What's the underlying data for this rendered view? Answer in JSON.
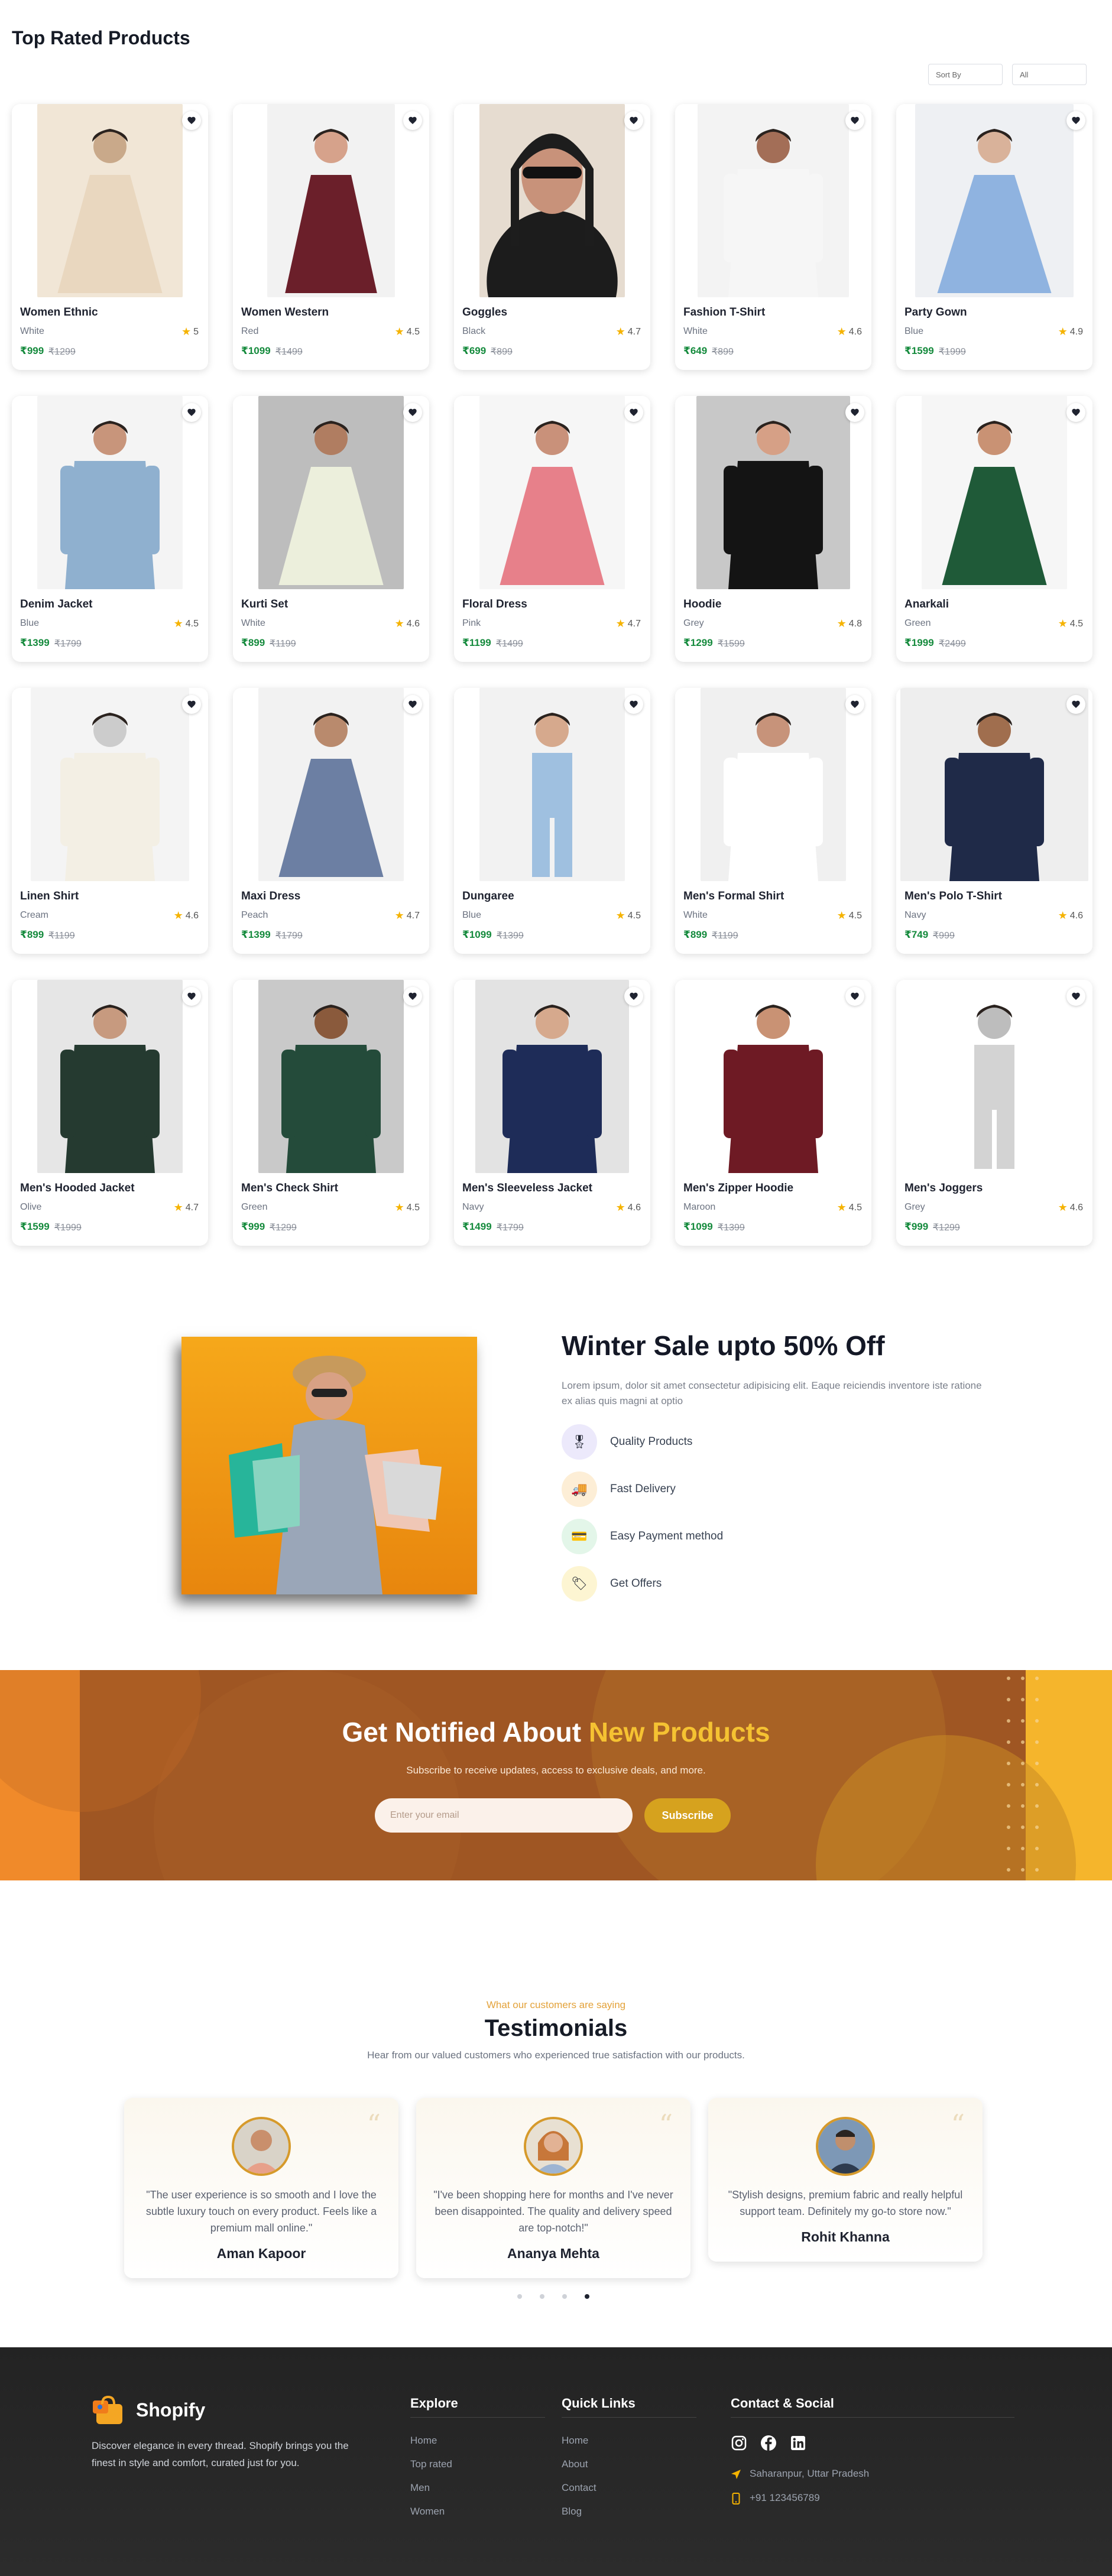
{
  "page": {
    "title": "Top Rated Products"
  },
  "filters": {
    "sort_placeholder": "Sort By",
    "category_value": "All"
  },
  "products": [
    {
      "name": "Women Ethnic",
      "color": "White",
      "rating": "5",
      "price": "₹999",
      "mrp": "₹1299"
    },
    {
      "name": "Women Western",
      "color": "Red",
      "rating": "4.5",
      "price": "₹1099",
      "mrp": "₹1499"
    },
    {
      "name": "Goggles",
      "color": "Black",
      "rating": "4.7",
      "price": "₹699",
      "mrp": "₹899"
    },
    {
      "name": "Fashion T-Shirt",
      "color": "White",
      "rating": "4.6",
      "price": "₹649",
      "mrp": "₹899"
    },
    {
      "name": "Party Gown",
      "color": "Blue",
      "rating": "4.9",
      "price": "₹1599",
      "mrp": "₹1999"
    },
    {
      "name": "Denim Jacket",
      "color": "Blue",
      "rating": "4.5",
      "price": "₹1399",
      "mrp": "₹1799"
    },
    {
      "name": "Kurti Set",
      "color": "White",
      "rating": "4.6",
      "price": "₹899",
      "mrp": "₹1199"
    },
    {
      "name": "Floral Dress",
      "color": "Pink",
      "rating": "4.7",
      "price": "₹1199",
      "mrp": "₹1499"
    },
    {
      "name": "Hoodie",
      "color": "Grey",
      "rating": "4.8",
      "price": "₹1299",
      "mrp": "₹1599"
    },
    {
      "name": "Anarkali",
      "color": "Green",
      "rating": "4.5",
      "price": "₹1999",
      "mrp": "₹2499"
    },
    {
      "name": "Linen Shirt",
      "color": "Cream",
      "rating": "4.6",
      "price": "₹899",
      "mrp": "₹1199"
    },
    {
      "name": "Maxi Dress",
      "color": "Peach",
      "rating": "4.7",
      "price": "₹1399",
      "mrp": "₹1799"
    },
    {
      "name": "Dungaree",
      "color": "Blue",
      "rating": "4.5",
      "price": "₹1099",
      "mrp": "₹1399"
    },
    {
      "name": "Men's Formal Shirt",
      "color": "White",
      "rating": "4.5",
      "price": "₹899",
      "mrp": "₹1199"
    },
    {
      "name": "Men's Polo T-Shirt",
      "color": "Navy",
      "rating": "4.6",
      "price": "₹749",
      "mrp": "₹999"
    },
    {
      "name": "Men's Hooded Jacket",
      "color": "Olive",
      "rating": "4.7",
      "price": "₹1599",
      "mrp": "₹1999"
    },
    {
      "name": "Men's Check Shirt",
      "color": "Green",
      "rating": "4.5",
      "price": "₹999",
      "mrp": "₹1299"
    },
    {
      "name": "Men's Sleeveless Jacket",
      "color": "Navy",
      "rating": "4.6",
      "price": "₹1499",
      "mrp": "₹1799"
    },
    {
      "name": "Men's Zipper Hoodie",
      "color": "Maroon",
      "rating": "4.5",
      "price": "₹1099",
      "mrp": "₹1399"
    },
    {
      "name": "Men's Joggers",
      "color": "Grey",
      "rating": "4.6",
      "price": "₹999",
      "mrp": "₹1299"
    }
  ],
  "promo": {
    "title": "Winter Sale upto 50% Off",
    "description": "Lorem ipsum, dolor sit amet consectetur adipisicing elit. Eaque reiciendis inventore iste ratione ex alias quis magni at optio",
    "features": [
      "Quality Products",
      "Fast Delivery",
      "Easy Payment method",
      "Get Offers"
    ]
  },
  "newsletter": {
    "title_main": "Get Notified About",
    "title_highlight": "New Products",
    "subtitle": "Subscribe to receive updates, access to exclusive deals, and more.",
    "email_placeholder": "Enter your email",
    "button_label": "Subscribe"
  },
  "testimonials": {
    "eyebrow": "What our customers are saying",
    "title": "Testimonials",
    "subtitle": "Hear from our valued customers who experienced true satisfaction with our products.",
    "items": [
      {
        "text": "\"The user experience is so smooth and I love the subtle luxury touch on every product. Feels like a premium mall online.\"",
        "name": "Aman Kapoor"
      },
      {
        "text": "\"I've been shopping here for months and I've never been disappointed. The quality and delivery speed are top-notch!\"",
        "name": "Ananya Mehta"
      },
      {
        "text": "\"Stylish designs, premium fabric and really helpful support team. Definitely my go-to store now.\"",
        "name": "Rohit Khanna"
      }
    ]
  },
  "footer": {
    "brand": "Shopify",
    "tagline": "Discover elegance in every thread. Shopify brings you the finest in style and comfort, curated just for you.",
    "explore_title": "Explore",
    "explore_links": [
      "Home",
      "Top rated",
      "Men",
      "Women"
    ],
    "quick_title": "Quick Links",
    "quick_links": [
      "Home",
      "About",
      "Contact",
      "Blog"
    ],
    "contact_title": "Contact & Social",
    "address": "Saharanpur, Uttar Pradesh",
    "phone": "+91 123456789"
  },
  "colors": {
    "accent_gold": "#d6a21e",
    "price_green": "#148a3c",
    "star": "#f5b301"
  }
}
